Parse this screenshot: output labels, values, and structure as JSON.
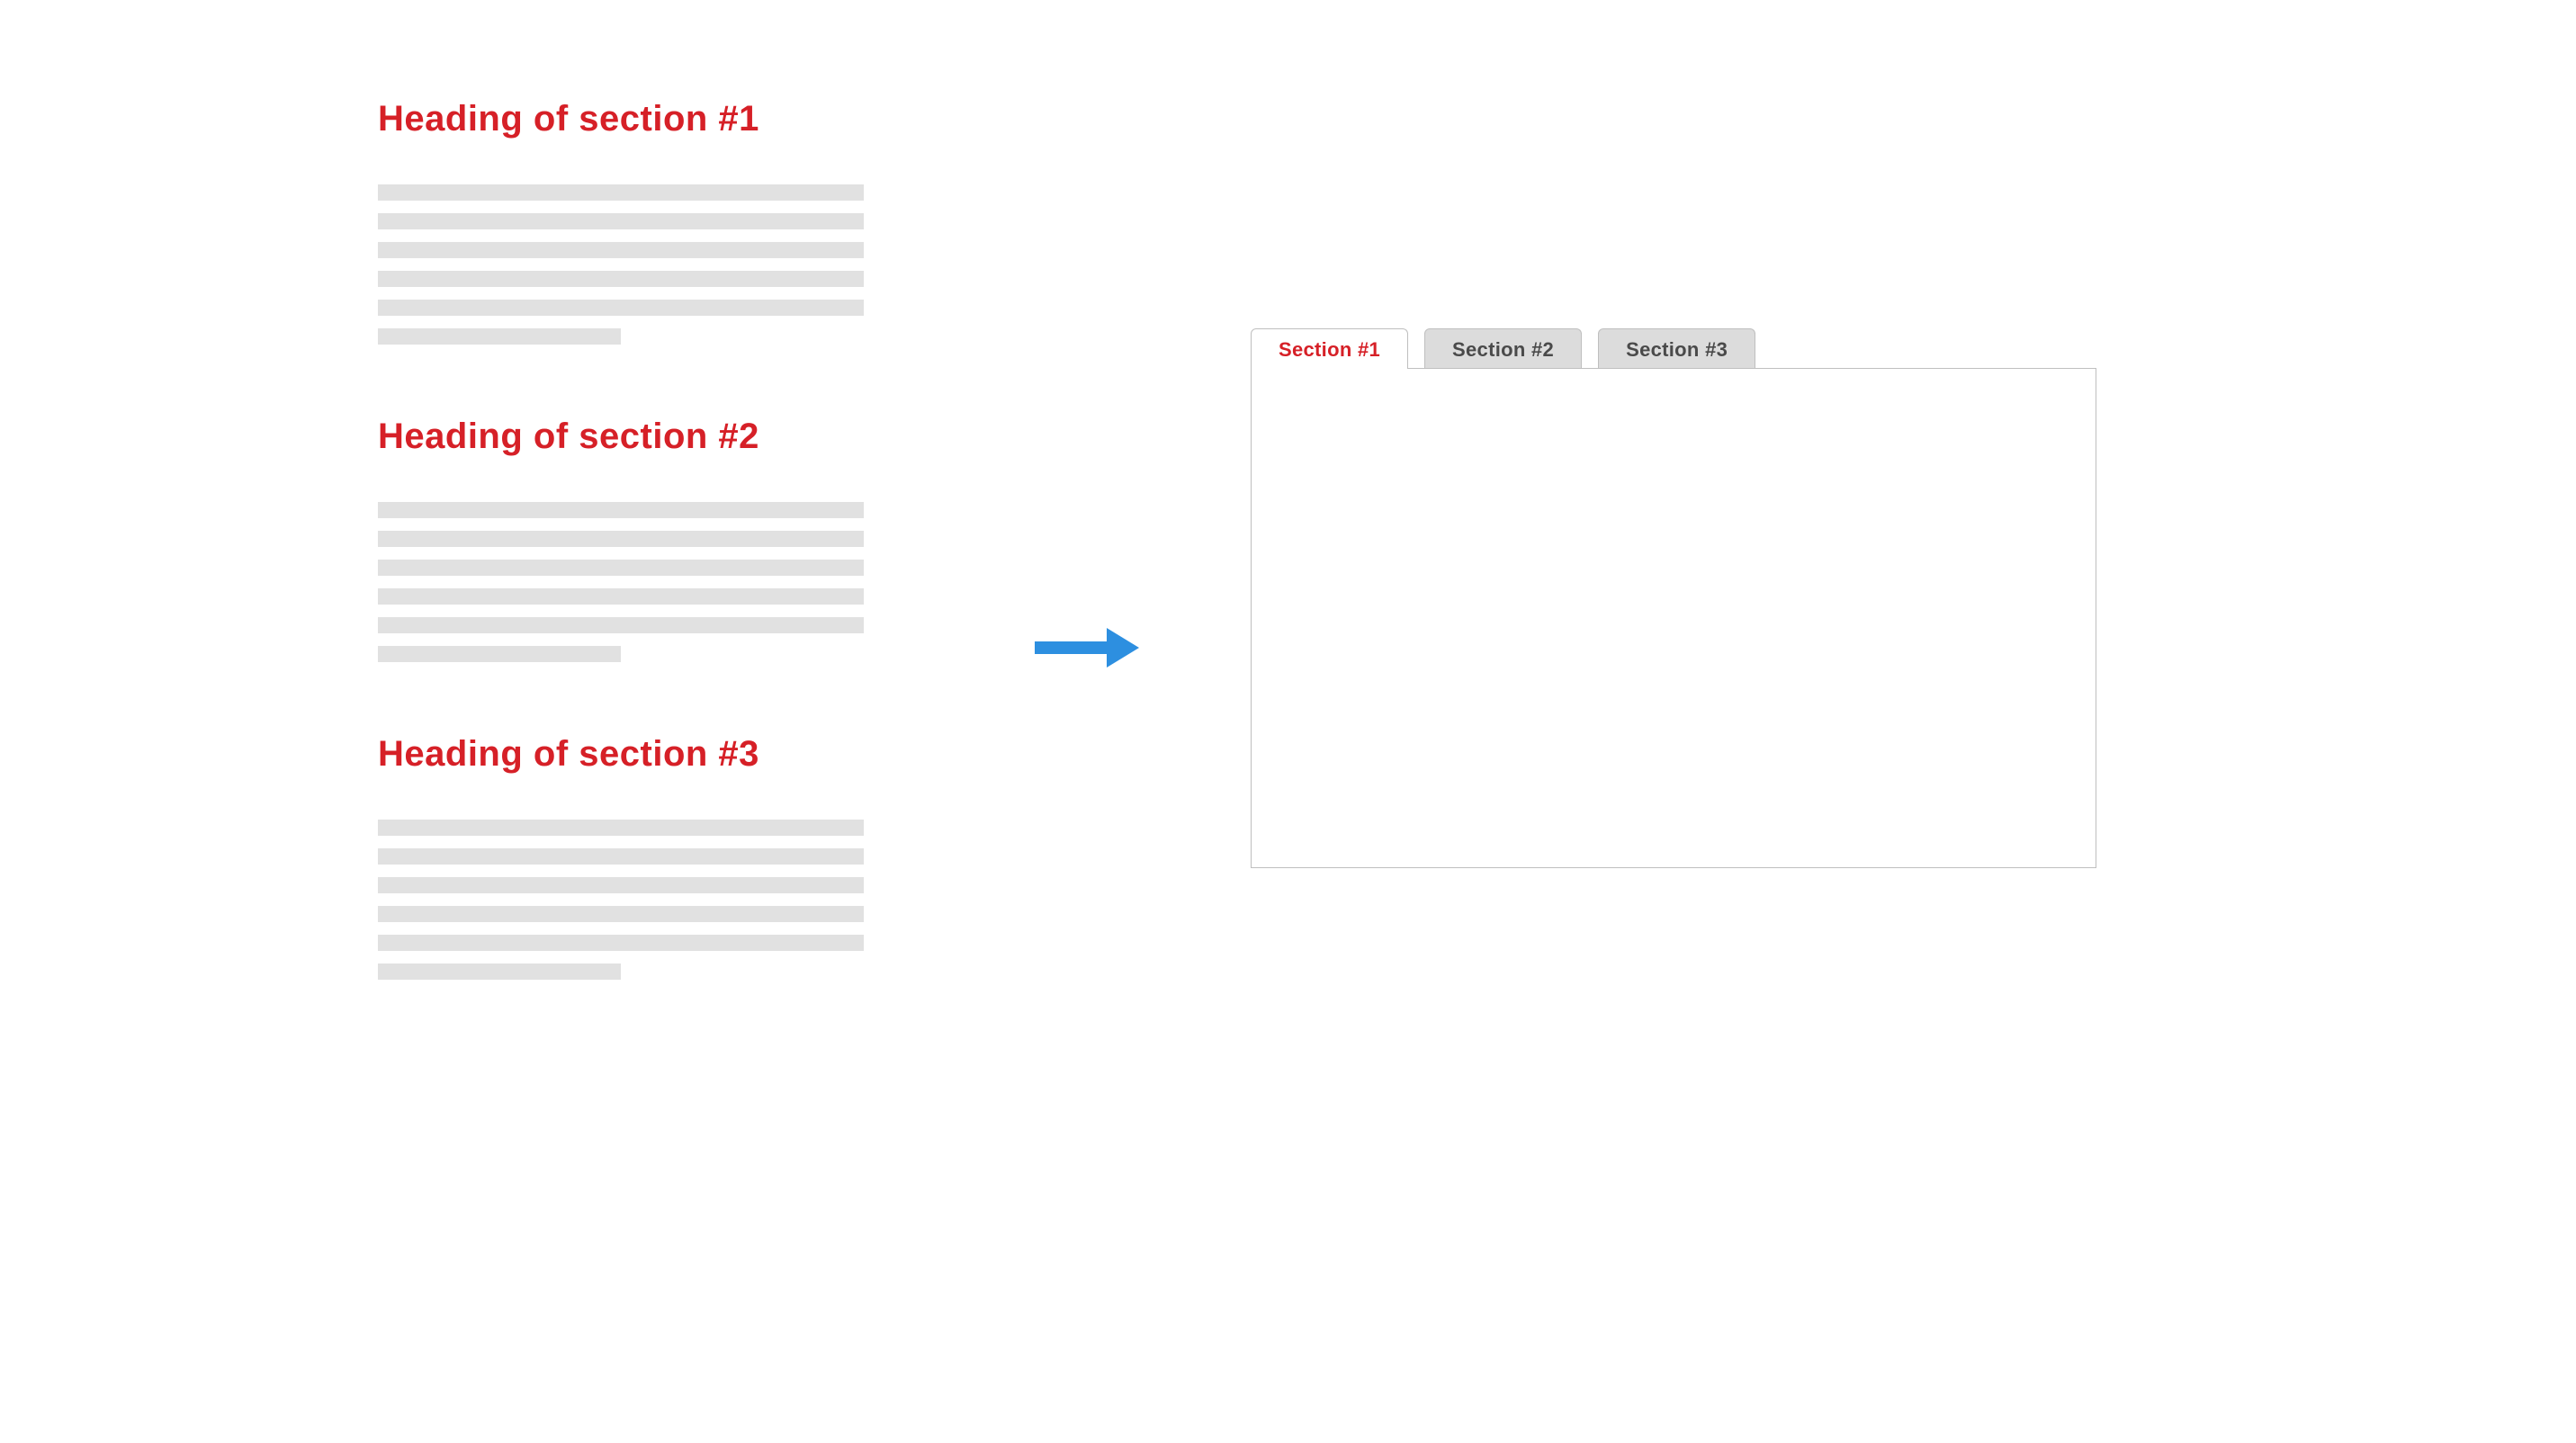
{
  "sections": [
    {
      "heading": "Heading of section #1"
    },
    {
      "heading": "Heading of section #2"
    },
    {
      "heading": "Heading of section #3"
    }
  ],
  "tabs": [
    {
      "label": "Section #1",
      "active": true
    },
    {
      "label": "Section #2",
      "active": false
    },
    {
      "label": "Section #3",
      "active": false
    }
  ],
  "colors": {
    "heading_red": "#d62027",
    "placeholder_gray": "#e1e1e1",
    "arrow_blue": "#2d8fe0",
    "tab_inactive_bg": "#dcdcdc",
    "tab_border": "#bfbfbf"
  }
}
